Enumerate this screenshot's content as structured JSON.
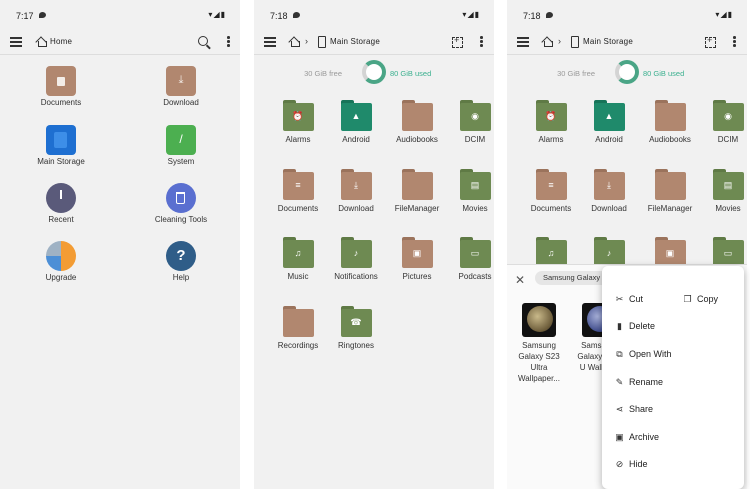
{
  "panels": [
    {
      "time": "7:17",
      "title": "Home"
    },
    {
      "time": "7:18",
      "title": "Main Storage"
    },
    {
      "time": "7:18",
      "title": "Main Storage"
    }
  ],
  "status_icons": "▾◢▮",
  "home_items": [
    {
      "label": "Documents",
      "icon": "documents-icon",
      "color": "#b1876f"
    },
    {
      "label": "Download",
      "icon": "download-icon",
      "color": "#b1876f"
    },
    {
      "label": "Main Storage",
      "icon": "sdcard-icon",
      "color": "#1e6fd1"
    },
    {
      "label": "System",
      "icon": "system-icon",
      "color": "#4caf50"
    },
    {
      "label": "Recent",
      "icon": "clock-icon",
      "color": "#5a5a7a"
    },
    {
      "label": "Cleaning Tools",
      "icon": "trash-icon",
      "color": "#5a6fd0"
    },
    {
      "label": "Upgrade",
      "icon": "upgrade-icon",
      "color": "#f39c34"
    },
    {
      "label": "Help",
      "icon": "help-icon",
      "color": "#2f5d88"
    }
  ],
  "storage": {
    "free": "30 GiB free",
    "used": "80 GiB used"
  },
  "folders": [
    {
      "label": "Alarms",
      "color": "olive",
      "glyph": "⏰"
    },
    {
      "label": "Android",
      "color": "teal",
      "glyph": "▲"
    },
    {
      "label": "Audiobooks",
      "color": "brown",
      "glyph": ""
    },
    {
      "label": "DCIM",
      "color": "olive",
      "glyph": "◉"
    },
    {
      "label": "Documents",
      "color": "brown",
      "glyph": "≡"
    },
    {
      "label": "Download",
      "color": "brown",
      "glyph": "⤓"
    },
    {
      "label": "FileManager",
      "color": "brown",
      "glyph": ""
    },
    {
      "label": "Movies",
      "color": "olive",
      "glyph": "▤"
    },
    {
      "label": "Music",
      "color": "olive",
      "glyph": "♫"
    },
    {
      "label": "Notifications",
      "color": "olive",
      "glyph": "♪"
    },
    {
      "label": "Pictures",
      "color": "brown",
      "glyph": "▣"
    },
    {
      "label": "Podcasts",
      "color": "olive",
      "glyph": "▭"
    },
    {
      "label": "Recordings",
      "color": "brown",
      "glyph": ""
    },
    {
      "label": "Ringtones",
      "color": "olive",
      "glyph": "☎"
    }
  ],
  "sheet": {
    "chip": "Samsung Galaxy",
    "items": [
      {
        "label": "Samsung Galaxy S23 Ultra Wallpaper..."
      },
      {
        "label": "Samsung Galaxy S23 U Wallpap"
      }
    ]
  },
  "menu": [
    {
      "label": "Cut",
      "icon": "scissors-icon"
    },
    {
      "label": "Copy",
      "icon": "copy-icon"
    },
    {
      "label": "Delete",
      "icon": "delete-icon"
    },
    {
      "label": "Open With",
      "icon": "open-with-icon"
    },
    {
      "label": "Rename",
      "icon": "rename-icon"
    },
    {
      "label": "Share",
      "icon": "share-icon"
    },
    {
      "label": "Archive",
      "icon": "archive-icon"
    },
    {
      "label": "Hide",
      "icon": "hide-icon"
    }
  ]
}
